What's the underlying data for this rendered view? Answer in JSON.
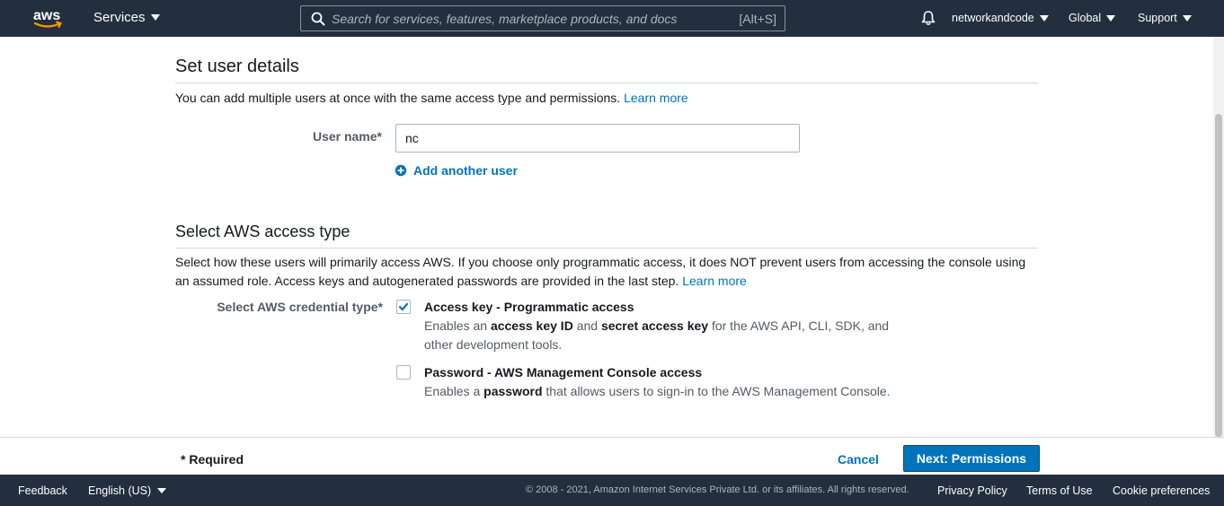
{
  "topnav": {
    "logo_text": "aws",
    "services_label": "Services",
    "search_placeholder": "Search for services, features, marketplace products, and docs",
    "search_shortcut": "[Alt+S]",
    "account_label": "networkandcode",
    "region_label": "Global",
    "support_label": "Support"
  },
  "user_details": {
    "title": "Set user details",
    "description": "You can add multiple users at once with the same access type and permissions.",
    "learn_more": "Learn more",
    "user_name_label": "User name*",
    "user_name_value": "nc",
    "add_another_user": "Add another user"
  },
  "access_type": {
    "title": "Select AWS access type",
    "description": "Select how these users will primarily access AWS. If you choose only programmatic access, it does NOT prevent users from accessing the console using an assumed role. Access keys and autogenerated passwords are provided in the last step.",
    "learn_more": "Learn more",
    "credential_label": "Select AWS credential type*",
    "options": [
      {
        "title": "Access key - Programmatic access",
        "checked": true,
        "desc_pre": "Enables an",
        "desc_bold1": "access key ID",
        "desc_mid": "and",
        "desc_bold2": "secret access key",
        "desc_post": "for the AWS API, CLI, SDK, and other development tools."
      },
      {
        "title": "Password - AWS Management Console access",
        "checked": false,
        "desc_pre": "Enables a",
        "desc_bold1": "password",
        "desc_post": "that allows users to sign-in to the AWS Management Console."
      }
    ]
  },
  "actions": {
    "required_note": "* Required",
    "cancel_label": "Cancel",
    "next_label": "Next: Permissions"
  },
  "footer": {
    "feedback": "Feedback",
    "language": "English (US)",
    "copyright": "© 2008 - 2021, Amazon Internet Services Private Ltd. or its affiliates. All rights reserved.",
    "privacy": "Privacy Policy",
    "terms": "Terms of Use",
    "cookies": "Cookie preferences"
  },
  "colors": {
    "nav_bg": "#232f3e",
    "link": "#0073bb",
    "primary_button": "#0073bb",
    "aws_orange": "#ff9900"
  },
  "icons": [
    "aws-logo",
    "search-icon",
    "bell-icon",
    "caret-down-icon",
    "plus-circle-icon",
    "checkmark-icon"
  ]
}
